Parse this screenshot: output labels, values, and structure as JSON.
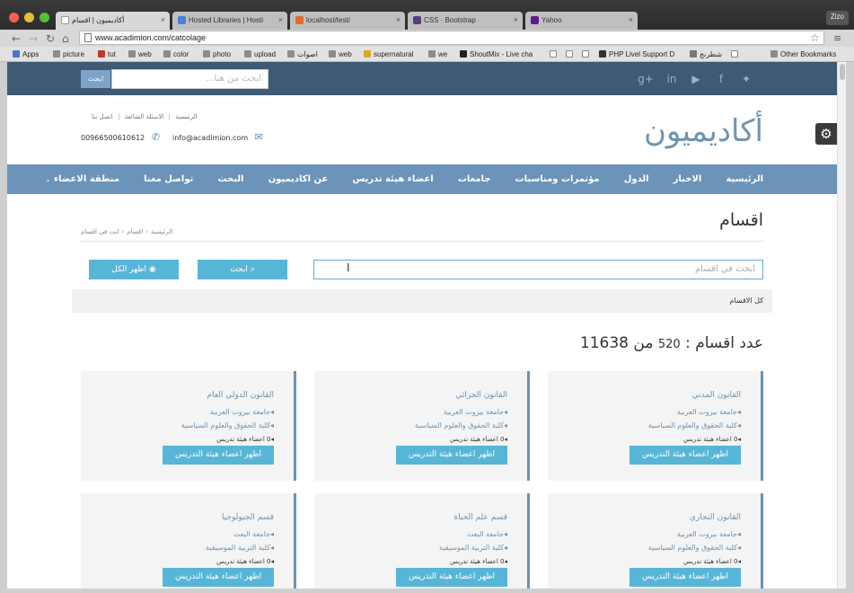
{
  "browser": {
    "tabs": [
      {
        "title": "أكاديميون | اقسام",
        "active": true
      },
      {
        "title": "Hosted Libraries | Hosti",
        "active": false
      },
      {
        "title": "localhost/test/",
        "active": false
      },
      {
        "title": "CSS · Bootstrap",
        "active": false
      },
      {
        "title": "Yahoo",
        "active": false
      }
    ],
    "profile": "Zizo",
    "url": "www.acadimion.com/catcolage",
    "bookmarks": [
      "Apps",
      "picture",
      "tut",
      "web",
      "color",
      "photo",
      "upload",
      "اصوات",
      "web",
      "supernatural",
      "we",
      "ShoutMix - Live cha",
      "PHP Livel Support D",
      "شطرنج",
      "Other Bookmarks"
    ]
  },
  "site": {
    "top_search_button": "ابحث",
    "top_search_placeholder": "ابحث من هنا...",
    "logo": "أكاديميون",
    "top_links": [
      "الرئيسية",
      "الاسئلة الشائعة",
      "اتصل بنا"
    ],
    "email": "info@acadimion.com",
    "phone": "00966500610612",
    "nav": [
      "الرئيسية",
      "الاخبار",
      "الدول",
      "مؤتمرات ومناسبات",
      "جامعات",
      "اعضاء هيئة تدريس",
      "عن اكاديميون",
      "البحث",
      "تواصل معنا",
      "منطقة الاعضاء"
    ],
    "page_title": "اقسام",
    "breadcrumb": [
      "الرئيسية",
      "اقسام",
      "انت في اقسام"
    ],
    "search_placeholder": "ابحث في اقسام",
    "search_button": "ابحث",
    "show_all_button": "اظهر الكل",
    "all_categories": "كل الاقسام",
    "count_label": "عدد اقسام :",
    "count_shown": "520",
    "count_of": "من",
    "count_total": "11638",
    "cards": [
      {
        "title": "القانون المدني",
        "university": "جامعة بيروت العربية",
        "faculty": "كلية الحقوق والعلوم السياسية",
        "members": "0 اعضاء هيئة تدريس",
        "button": "اظهر اعضاء هيئة التدريس"
      },
      {
        "title": "القانون الجزائي",
        "university": "جامعة بيروت العربية",
        "faculty": "كلية الحقوق والعلوم السياسية",
        "members": "0 اعضاء هيئة تدريس",
        "button": "اظهر اعضاء هيئة التدريس"
      },
      {
        "title": "القانون الدولي العام",
        "university": "جامعة بيروت العربية",
        "faculty": "كلية الحقوق والعلوم السياسية",
        "members": "0 اعضاء هيئة تدريس",
        "button": "اظهر اعضاء هيئة التدريس"
      },
      {
        "title": "القانون التجاري",
        "university": "جامعة بيروت العربية",
        "faculty": "كلية الحقوق والعلوم السياسية",
        "members": "0 اعضاء هيئة تدريس",
        "button": "اظهر اعضاء هيئة التدريس"
      },
      {
        "title": "قسم علم الحياة",
        "university": "جامعة البعث",
        "faculty": "كلية التربية الموسيقية",
        "members": "0 اعضاء هيئة تدريس",
        "button": "اظهر اعضاء هيئة التدريس"
      },
      {
        "title": "قسم الجيولوجيا",
        "university": "جامعة البعث",
        "faculty": "كلية التربية الموسيقية",
        "members": "0 اعضاء هيئة تدريس",
        "button": "اظهر اعضاء هيئة التدريس"
      }
    ]
  }
}
